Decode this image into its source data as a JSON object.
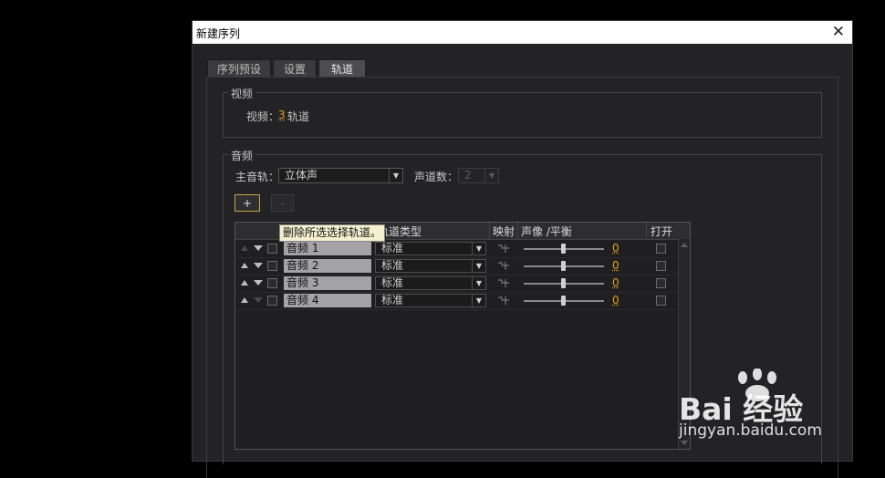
{
  "dialog": {
    "title": "新建序列"
  },
  "tabs": [
    "序列预设",
    "设置",
    "轨道"
  ],
  "video": {
    "group_label": "视频",
    "label": "视频：",
    "count": "3",
    "suffix": "轨道"
  },
  "audio": {
    "group_label": "音频",
    "master_label": "主音轨：",
    "master_value": "立体声",
    "channels_label": "声道数：",
    "channels_value": "2",
    "add_label": "+",
    "remove_label": "-"
  },
  "tooltip": "删除所选选择轨道。",
  "table": {
    "headers": {
      "type": "轨道类型",
      "map": "映射",
      "pan": "声像 /平衡",
      "open": "打开"
    },
    "rows": [
      {
        "name": "音频 1",
        "type": "标准",
        "pan": "0"
      },
      {
        "name": "音频 2",
        "type": "标准",
        "pan": "0"
      },
      {
        "name": "音频 3",
        "type": "标准",
        "pan": "0"
      },
      {
        "name": "音频 4",
        "type": "标准",
        "pan": "0"
      }
    ]
  },
  "watermark": {
    "brand": "Bai  经验",
    "url": "jingyan.baidu.com"
  }
}
